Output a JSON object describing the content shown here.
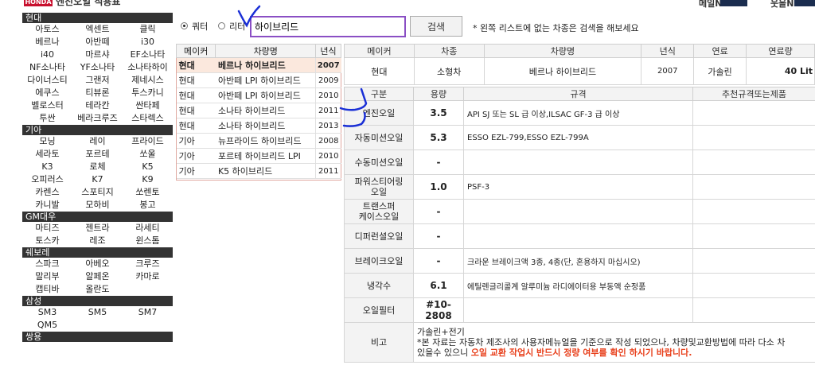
{
  "header": {
    "badge": "HONDA",
    "title": "엔진오일 적용표",
    "right_a": "메일N",
    "right_b": "웃을N"
  },
  "sidebar": {
    "groups": [
      {
        "brand": "현대",
        "cars": [
          "아토스",
          "엑센트",
          "클릭",
          "베르나",
          "아반떼",
          "i30",
          "i40",
          "마르샤",
          "EF소나타",
          "NF소나타",
          "YF소나타",
          "소나타하이",
          "다이너스티",
          "그랜저",
          "제네시스",
          "에쿠스",
          "티뷰론",
          "투스카니",
          "벨로스터",
          "테라칸",
          "싼타페",
          "투싼",
          "베라크루즈",
          "스타렉스"
        ]
      },
      {
        "brand": "기아",
        "cars": [
          "모닝",
          "레이",
          "프라이드",
          "세라토",
          "포르테",
          "쏘울",
          "K3",
          "로체",
          "K5",
          "오피러스",
          "K7",
          "K9",
          "카렌스",
          "스포티지",
          "쏘렌토",
          "카니발",
          "모하비",
          "봉고"
        ]
      },
      {
        "brand": "GM대우",
        "cars": [
          "마티즈",
          "젠트라",
          "라세티",
          "토스카",
          "레조",
          "윈스톰"
        ]
      },
      {
        "brand": "쉐보레",
        "cars": [
          "스파크",
          "아베오",
          "크루즈",
          "말리부",
          "알페온",
          "카마로",
          "캡티바",
          "올란도"
        ]
      },
      {
        "brand": "삼성",
        "cars": [
          "SM3",
          "SM5",
          "SM7",
          "QM5"
        ]
      },
      {
        "brand": "쌍용",
        "cars": []
      }
    ]
  },
  "search": {
    "radio1": "쿼터",
    "radio2": "리터",
    "value": "하이브리드",
    "button": "검색",
    "note": "* 왼쪽 리스트에 없는 차종은 검색을 해보세요"
  },
  "results": {
    "headers": [
      "메이커",
      "차량명",
      "년식"
    ],
    "rows": [
      {
        "maker": "현대",
        "name": "베르나 하이브리드",
        "year": "2007"
      },
      {
        "maker": "현대",
        "name": "아반떼 LPI 하이브리드",
        "year": "2009"
      },
      {
        "maker": "현대",
        "name": "아반떼 LPI 하이브리드",
        "year": "2010"
      },
      {
        "maker": "현대",
        "name": "소나타 하이브리드",
        "year": "2011"
      },
      {
        "maker": "현대",
        "name": "소나타 하이브리드",
        "year": "2013"
      },
      {
        "maker": "기아",
        "name": "뉴프라이드 하이브리드",
        "year": "2008"
      },
      {
        "maker": "기아",
        "name": "포르테 하이브리드 LPI",
        "year": "2010"
      },
      {
        "maker": "기아",
        "name": "K5 하이브리드",
        "year": "2011"
      }
    ]
  },
  "detail": {
    "headers": [
      "메이커",
      "차종",
      "차량명",
      "년식",
      "연료",
      "연료량"
    ],
    "maker": "현대",
    "type": "소형차",
    "name": "베르나 하이브리드",
    "year": "2007",
    "fuel": "가솔린",
    "fuel_amount": "40 Lit"
  },
  "spec": {
    "headers": [
      "구분",
      "용량",
      "규격",
      "추천규격또는제품"
    ],
    "rows": [
      {
        "name": "엔진오일",
        "vol": "3.5",
        "std": "API SJ 또는 SL 급 이상,ILSAC GF-3 급 이상"
      },
      {
        "name": "자동미션오일",
        "vol": "5.3",
        "std": "ESSO EZL-799,ESSO EZL-799A"
      },
      {
        "name": "수동미션오일",
        "vol": "-",
        "std": ""
      },
      {
        "name": "파워스티어링\n오일",
        "vol": "1.0",
        "std": "PSF-3"
      },
      {
        "name": "트랜스퍼\n케이스오일",
        "vol": "-",
        "std": ""
      },
      {
        "name": "디퍼런셜오일",
        "vol": "-",
        "std": ""
      },
      {
        "name": "브레이크오일",
        "vol": "-",
        "std": "크라운 브레이크액 3종, 4종(단, 혼용하지 마십시오)"
      },
      {
        "name": "냉각수",
        "vol": "6.1",
        "std": "에틸렌글리콜계 알루미늄 라디에이터용 부동액 순정품"
      },
      {
        "name": "오일필터",
        "vol": "#10-2808",
        "std": ""
      }
    ],
    "remark_label": "비고",
    "remark_line1": "가솔린+전기",
    "remark_line2": "*본 자료는 자동차 제조사의 사용자메뉴얼을 기준으로 작성 되었으나, 차량및교환방법에 따라 다소 차",
    "remark_line3a": "있을수 있으니 ",
    "remark_line3b": "오일 교환 작업시 반드시 정량 여부를 확인 하시기 바랍니다."
  },
  "colors": {
    "accent": "#8a4fc4",
    "header_dark": "#333333",
    "warn": "#e8401c",
    "selected_row": "#fbe8dd",
    "mark_blue": "#1a2fd6"
  }
}
